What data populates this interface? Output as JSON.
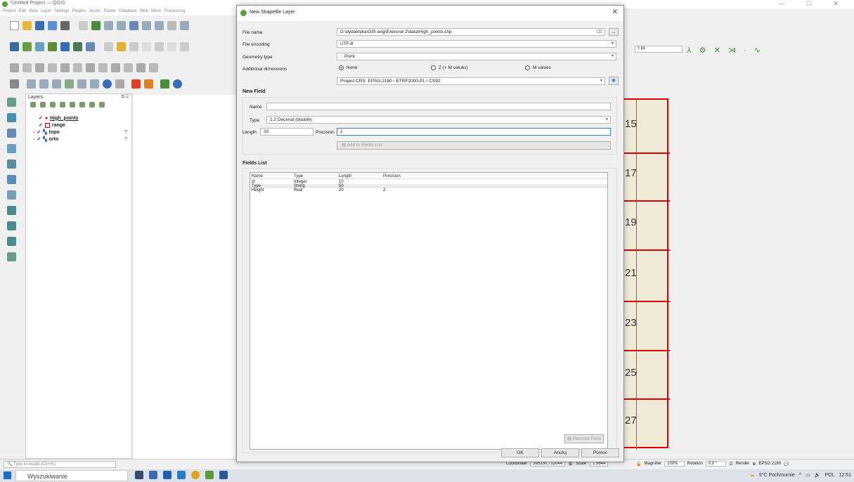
{
  "window": {
    "title": "*Untitled Project — QGIS",
    "controls": "— ☐ ✕"
  },
  "menubar": [
    "Project",
    "Edit",
    "View",
    "Layer",
    "Settings",
    "Plugins",
    "Vector",
    "Raster",
    "Database",
    "Web",
    "Mesh",
    "Processing"
  ],
  "layers_panel": {
    "title": "Layers",
    "layers": [
      {
        "name": "High_points",
        "checked": true
      },
      {
        "name": "range",
        "checked": true
      },
      {
        "name": "topo",
        "checked": true,
        "badge": "?"
      },
      {
        "name": "orto",
        "checked": true,
        "badge": "?"
      }
    ]
  },
  "locate": {
    "placeholder": "Type to locate (Ctrl+K)"
  },
  "map_labels": [
    "15",
    "17",
    "19",
    "21",
    "23",
    "25",
    "27"
  ],
  "right_toolbar": {
    "px_unit": "px"
  },
  "status": {
    "coordinate_label": "Coordinate",
    "coordinate": "395330,712044",
    "scale_label": "Scale",
    "scale": "1:9644",
    "magnifier_label": "Magnifier",
    "magnifier": "100%",
    "rotation_label": "Rotation",
    "rotation": "0,0 °",
    "render_label": "Render",
    "crs": "EPSG:2180"
  },
  "taskbar": {
    "search": "Wyszukiwanie",
    "weather": "9°C Pochmurnie",
    "lang": "POL",
    "time": "12:51"
  },
  "dialog": {
    "title": "New Shapefile Layer",
    "file_name_label": "File name",
    "file_name": "D:\\dydaktyka\\GIS-ang\\Exercise 2\\data\\High_points.shp",
    "file_browse": "...",
    "encoding_label": "File encoding",
    "encoding": "UTF-8",
    "geometry_label": "Geometry type",
    "geometry": "Point",
    "dims_label": "Additional dimensions",
    "dims_options": [
      "None",
      "Z (+ M values)",
      "M values"
    ],
    "crs": "Project CRS: EPSG:2180 - ETRF2000-PL / CS92",
    "new_field_title": "New Field",
    "name_label": "Name",
    "name_value": "",
    "type_label": "Type",
    "type_value": "1.2 Decimal (double)",
    "length_label": "Length",
    "length_value": "20",
    "precision_label": "Precision",
    "precision_value": "2",
    "add_button": "Add to Fields List",
    "fields_list_title": "Fields List",
    "columns": [
      "Name",
      "Type",
      "Length",
      "Precision"
    ],
    "rows": [
      [
        "id",
        "Integer",
        "10",
        ""
      ],
      [
        "Type",
        "String",
        "50",
        ""
      ],
      [
        "Height",
        "Real",
        "20",
        "2"
      ]
    ],
    "remove_button": "Remove Field",
    "ok": "OK",
    "cancel": "Anuluj",
    "help": "Pomoc"
  }
}
